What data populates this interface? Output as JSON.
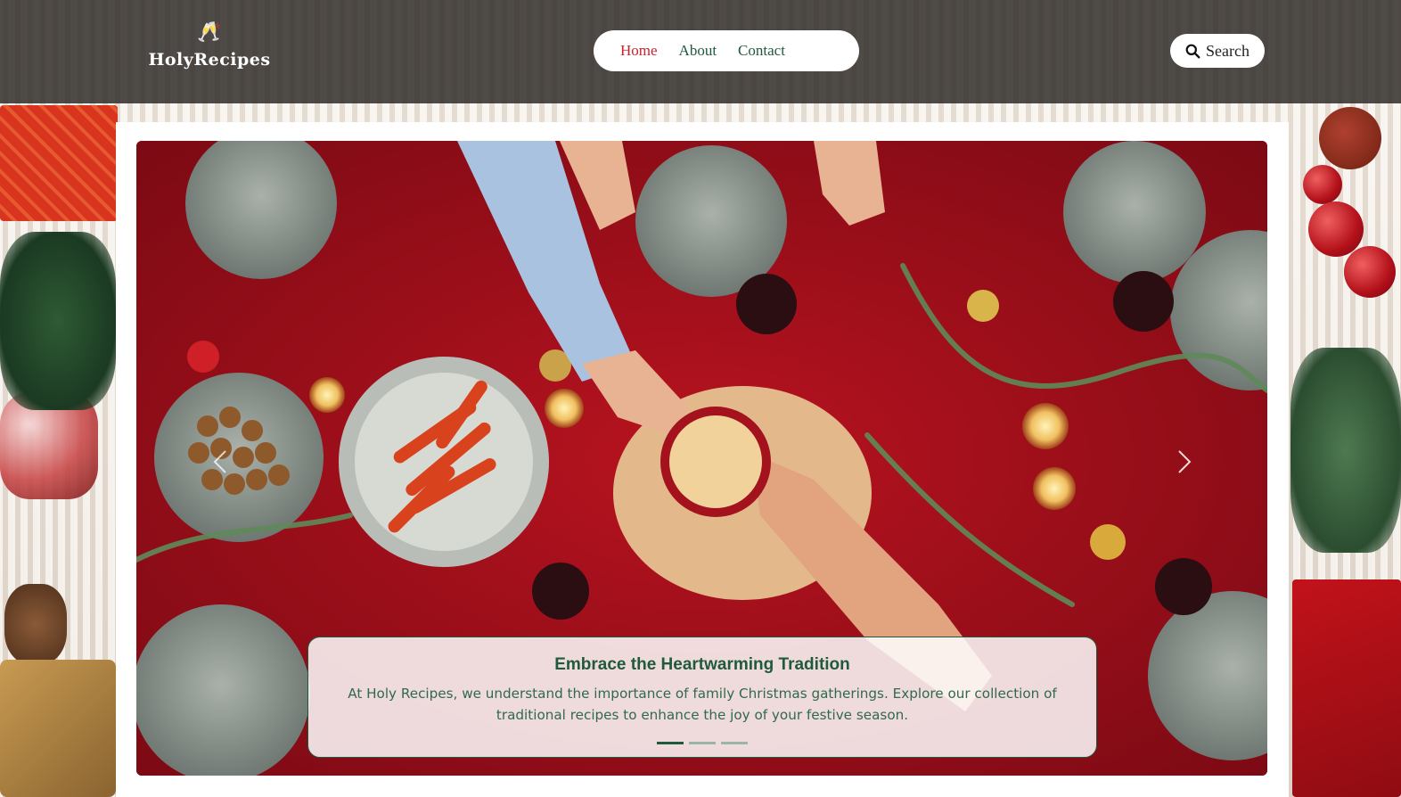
{
  "brand": {
    "name": "HolyRecipes"
  },
  "nav": {
    "items": [
      {
        "label": "Home",
        "active": true
      },
      {
        "label": "About",
        "active": false
      },
      {
        "label": "Contact",
        "active": false
      }
    ]
  },
  "search": {
    "label": "Search",
    "icon": "search-icon"
  },
  "hero": {
    "image_alt": "festive Christmas table",
    "prev_icon": "chevron-left-icon",
    "next_icon": "chevron-right-icon",
    "caption": {
      "title": "Embrace the Heartwarming Tradition",
      "text": "At Holy Recipes, we understand the importance of family Christmas gatherings. Explore our collection of traditional recipes to enhance the joy of your festive season."
    },
    "slides_total": 3,
    "active_slide": 1
  },
  "colors": {
    "accent_green": "#1f5a3c",
    "accent_red": "#c8232c",
    "header_dark": "#282421"
  }
}
